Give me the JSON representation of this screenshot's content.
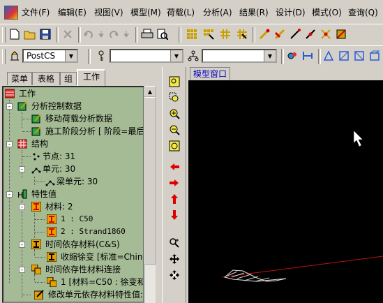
{
  "menu": {
    "items": [
      "文件(F)",
      "编辑(E)",
      "视图(V)",
      "模型(M)",
      "荷载(L)",
      "分析(A)",
      "结果(R)",
      "设计(D)",
      "模式(O)",
      "查询(Q)"
    ]
  },
  "toolbar2": {
    "stage_combo": "PostCS",
    "combo2_value": "",
    "combo3_value": ""
  },
  "panel": {
    "tabs": [
      "菜单",
      "表格",
      "组",
      "工作"
    ],
    "active_tab": "工作"
  },
  "tree": {
    "nodes": [
      {
        "label": "工作",
        "level": 0,
        "icon": "work-icon",
        "expander": "-"
      },
      {
        "label": "分析控制数据",
        "level": 1,
        "icon": "analysis-control-icon",
        "expander": "-"
      },
      {
        "label": "移动荷载分析数据",
        "level": 2,
        "icon": "moving-load-icon",
        "expander": ""
      },
      {
        "label": "施工阶段分析 [ 阶段=最后",
        "level": 2,
        "icon": "construction-stage-icon",
        "expander": ""
      },
      {
        "label": "结构",
        "level": 1,
        "icon": "structure-icon",
        "expander": "-"
      },
      {
        "label": "节点: 31",
        "level": 2,
        "icon": "node-icon",
        "expander": ""
      },
      {
        "label": "单元: 30",
        "level": 2,
        "icon": "element-icon",
        "expander": "-"
      },
      {
        "label": "梁单元: 30",
        "level": 3,
        "icon": "beam-element-icon",
        "expander": ""
      },
      {
        "label": "特性值",
        "level": 1,
        "icon": "property-icon",
        "expander": "-"
      },
      {
        "label": "材料: 2",
        "level": 2,
        "icon": "material-icon",
        "expander": "-"
      },
      {
        "label": "1 : C50",
        "level": 3,
        "icon": "material-item-icon",
        "expander": ""
      },
      {
        "label": "2 : Strand1860",
        "level": 3,
        "icon": "material-item-icon",
        "expander": ""
      },
      {
        "label": "时间依存材料(C&S)",
        "level": 2,
        "icon": "time-material-icon",
        "expander": "-"
      },
      {
        "label": "收缩徐变 [标准=China",
        "level": 3,
        "icon": "creep-icon",
        "expander": ""
      },
      {
        "label": "时间依存性材料连接",
        "level": 2,
        "icon": "link-icon",
        "expander": "-"
      },
      {
        "label": "1 [材料=C50 : 徐变和",
        "level": 3,
        "icon": "link-item-icon",
        "expander": ""
      },
      {
        "label": "修改单元依存材料特性值:",
        "level": 2,
        "icon": "modify-icon",
        "expander": ""
      }
    ]
  },
  "view": {
    "tab_label": "模型窗口"
  }
}
